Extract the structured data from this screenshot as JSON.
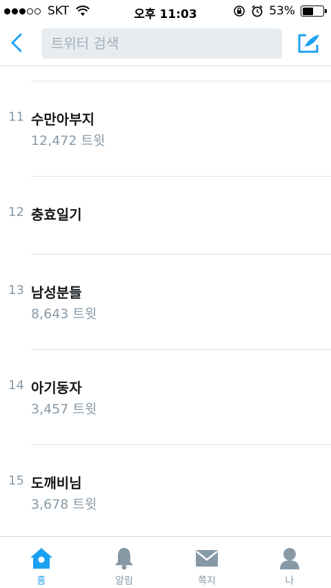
{
  "status_bar": {
    "carrier": "SKT",
    "time": "오후 11:03",
    "battery_percent": "53%",
    "battery_level": 0.53,
    "signal_bars_filled": 3,
    "signal_bars_total": 5
  },
  "nav": {
    "search_placeholder": "트위터 검색",
    "accent_color": "#1da1f2"
  },
  "trends": [
    {
      "rank": "11",
      "name": "수만아부지",
      "count": "12,472 트윗"
    },
    {
      "rank": "12",
      "name": "충효일기",
      "count": ""
    },
    {
      "rank": "13",
      "name": "남성분들",
      "count": "8,643 트윗"
    },
    {
      "rank": "14",
      "name": "아기동자",
      "count": "3,457 트윗"
    },
    {
      "rank": "15",
      "name": "도깨비님",
      "count": "3,678 트윗"
    }
  ],
  "tabs": [
    {
      "label": "홈",
      "icon": "home-icon",
      "active": true
    },
    {
      "label": "알림",
      "icon": "bell-icon",
      "active": false
    },
    {
      "label": "쪽지",
      "icon": "envelope-icon",
      "active": false
    },
    {
      "label": "나",
      "icon": "person-icon",
      "active": false
    }
  ]
}
